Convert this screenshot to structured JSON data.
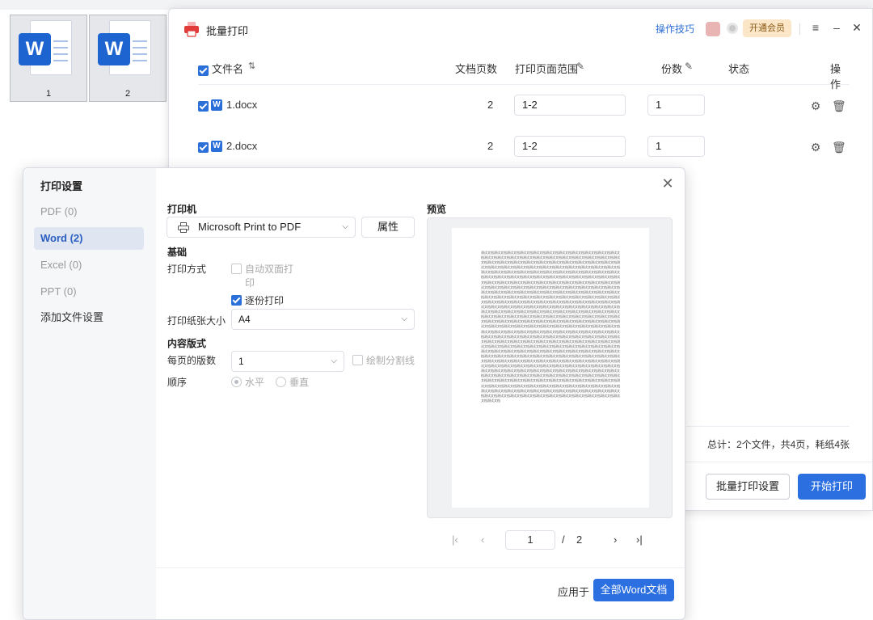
{
  "desktop": {
    "files": [
      {
        "name": "1",
        "badge": "W"
      },
      {
        "name": "2",
        "badge": "W"
      }
    ]
  },
  "window": {
    "title": "批量打印",
    "tips_link": "操作技巧",
    "vip_label": "开通会员",
    "controls": {
      "menu": "≡",
      "minimize": "–",
      "close": "✕"
    },
    "table": {
      "headers": {
        "filename": "文件名",
        "sort": "⇅",
        "pages": "文档页数",
        "range": "打印页面范围",
        "copies": "份数",
        "status": "状态",
        "actions": "操作"
      },
      "rows": [
        {
          "name": "1.docx",
          "pages": "2",
          "range": "1-2",
          "copies": "1",
          "status": ""
        },
        {
          "name": "2.docx",
          "pages": "2",
          "range": "1-2",
          "copies": "1",
          "status": ""
        }
      ]
    },
    "summary": "总计：2个文件，共4页，耗纸4张",
    "buttons": {
      "batch_settings": "批量打印设置",
      "start": "开始打印"
    }
  },
  "dialog": {
    "sidebar_title": "打印设置",
    "sidebar_items": [
      {
        "label": "PDF (0)"
      },
      {
        "label": "Word (2)"
      },
      {
        "label": "Excel (0)"
      },
      {
        "label": "PPT (0)"
      },
      {
        "label": "添加文件设置"
      }
    ],
    "printer_label": "打印机",
    "printer_value": "Microsoft Print to PDF",
    "properties_button": "属性",
    "basic_label": "基础",
    "print_mode_label": "打印方式",
    "duplex_label_1": "自动双面打",
    "duplex_label_2": "印",
    "collate_label": "逐份打印",
    "paper_size_label": "打印纸张大小",
    "paper_size_value": "A4",
    "layout_label": "内容版式",
    "pages_per_sheet_label": "每页的版数",
    "pages_per_sheet_value": "1",
    "draw_divider_label": "绘制分割线",
    "order_label": "顺序",
    "order_horizontal": "水平",
    "order_vertical": "垂直",
    "preview_label": "预览",
    "preview_text": "测试文档测试文档测试文档测试文档测试文档测试文档测试文档测试文档测试文档测试文档测试文档测试文档测试文档测试文档测试文档测试文档测试文档测试文档测试文档测试文档测试文档测试文档测试文档测试文档测试文档测试文档测试文档测试文档测试文档测试文档测试文档测试文档测试文档测试文档测试文档测试文档测试文档测试文档测试文档测试文档测试文档测试文档测试文档测试文档测试文档测试文档测试文档测试文档测试文档测试文档测试文档测试文档测试文档测试文档测试文档测试文档测试文档测试文档测试文档测试文档测试文档测试文档测试文档测试文档测试文档测试文档测试文档测试文档测试文档测试文档测试文档测试文档测试文档测试文档测试文档测试文档测试文档测试文档测试文档测试文档测试文档测试文档测试文档测试文档测试文档测试文档测试文档测试文档测试文档测试文档测试文档测试文档测试文档测试文档测试文档测试文档测试文档测试文档测试文档测试文档测试文档测试文档测试文档测试文档测试文档测试文档测试文档测试文档测试文档测试文档测试文档测试文档测试文档测试文档测试文档测试文档测试文档测试文档测试文档测试文档测试文档测试文档测试文档测试文档测试文档测试文档测试文档测试文档测试文档测试文档测试文档测试文档测试文档测试文档测试文档测试文档测试文档测试文档测试文档测试文档测试文档测试文档测试文档测试文档测试文档测试文档测试文档测试文档测试文档测试文档测试文档测试文档测试文档测试文档测试文档测试文档测试文档测试文档测试文档测试文档测试文档测试文档测试文档测试文档测试文档测试文档测试文档测试文档测试文档测试文档测试文档测试文档测试文档测试文档测试文档测试文档测试文档测试文档测试文档测试文档测试文档测试文档测试文档测试文档测试文档测试文档测试文档测试文档测试文档测试文档测试文档测试文档测试文档测试文档测试文档测试文档测试文档测试文档测试文档测试文档测试文档测试文档测试文档测试文档测试文档测试文档测试文档测试文档测试文档测试文档测试文档测试文档测试文档测试文档测试文档测试文档测试文档测试文档测试文档测试文档测试文档测试文档测试文档测试文档测试文档测试文档测试文档测试文档测试文档测试文档测试文档测试文档测试文档测试文档测试文档测试文档测试文档测试文档测试文档测试文档测试文档测试文档测试文档测试文档测试文档测试文档测试文档测试文档测试文档测试文档测试文档测试文档测试文档测试文档测试文档测试文档测试文档测试文档测试文档测试文档测试文档测试文档测试文档测试文档测试文档测试文档测试文档测试文档测试文档测试文档测试文档测试文档测试文档测试文档测试文档测试文档测试文档测试文档测试文档测试文档测试文档测试文档测试文档测试文档测试文档测试文档测试文档测试文档测试文档测试文档测试文档测试文档测试文档测试文档测试文档测试文档测试文档测试文档测试文档测试文档测试文档测试文档测试文档测试文档测试文档测试文档测试文档测试文档测试文档测试文档测试文档测试文档测试文档测试文档测试文档测试文档测试文档测试文档测试文档测试文档测试文档测试文档测试文档测试文档",
    "pager": {
      "current": "1",
      "separator": "/",
      "total": "2",
      "first": "|‹",
      "prev": "‹",
      "next": "›",
      "last": "›|"
    },
    "apply_to_label": "应用于",
    "apply_to_button": "全部Word文档"
  },
  "colors": {
    "accent": "#2b6fe0",
    "brand_red": "#e23b3b",
    "word_blue": "#1d64d0"
  }
}
